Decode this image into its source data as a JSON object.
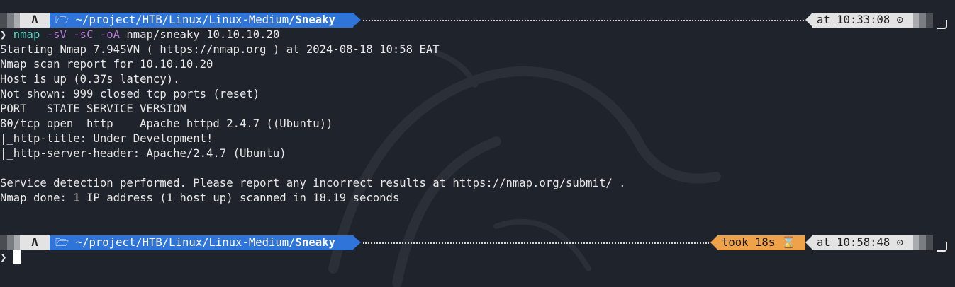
{
  "prompt1": {
    "os_glyph": "Λ",
    "folder_glyph": "🗁",
    "path": "~/project/HTB/Linux/Linux-Medium/",
    "path_bold": "Sneaky",
    "time": "at 10:33:08 ⊙"
  },
  "command": {
    "chevron": "❯",
    "name": "nmap",
    "flags": "-sV -sC -oA",
    "args": "nmap/sneaky 10.10.10.20"
  },
  "output": [
    "Starting Nmap 7.94SVN ( https://nmap.org ) at 2024-08-18 10:58 EAT",
    "Nmap scan report for 10.10.10.20",
    "Host is up (0.37s latency).",
    "Not shown: 999 closed tcp ports (reset)",
    "PORT   STATE SERVICE VERSION",
    "80/tcp open  http    Apache httpd 2.4.7 ((Ubuntu))",
    "|_http-title: Under Development!",
    "|_http-server-header: Apache/2.4.7 (Ubuntu)",
    "",
    "Service detection performed. Please report any incorrect results at https://nmap.org/submit/ .",
    "Nmap done: 1 IP address (1 host up) scanned in 18.19 seconds"
  ],
  "prompt2": {
    "os_glyph": "Λ",
    "folder_glyph": "🗁",
    "path": "~/project/HTB/Linux/Linux-Medium/",
    "path_bold": "Sneaky",
    "took": "took 18s ⌛",
    "time": "at 10:58:48 ⊙"
  },
  "input": {
    "chevron": "❯",
    "value": ""
  },
  "colors": {
    "background": "#1f232b",
    "path_segment": "#2f74d9",
    "took_segment": "#f0a24a",
    "time_segment": "#e3e3e3",
    "command": "#5fd3c6",
    "flags": "#b77ad6"
  }
}
